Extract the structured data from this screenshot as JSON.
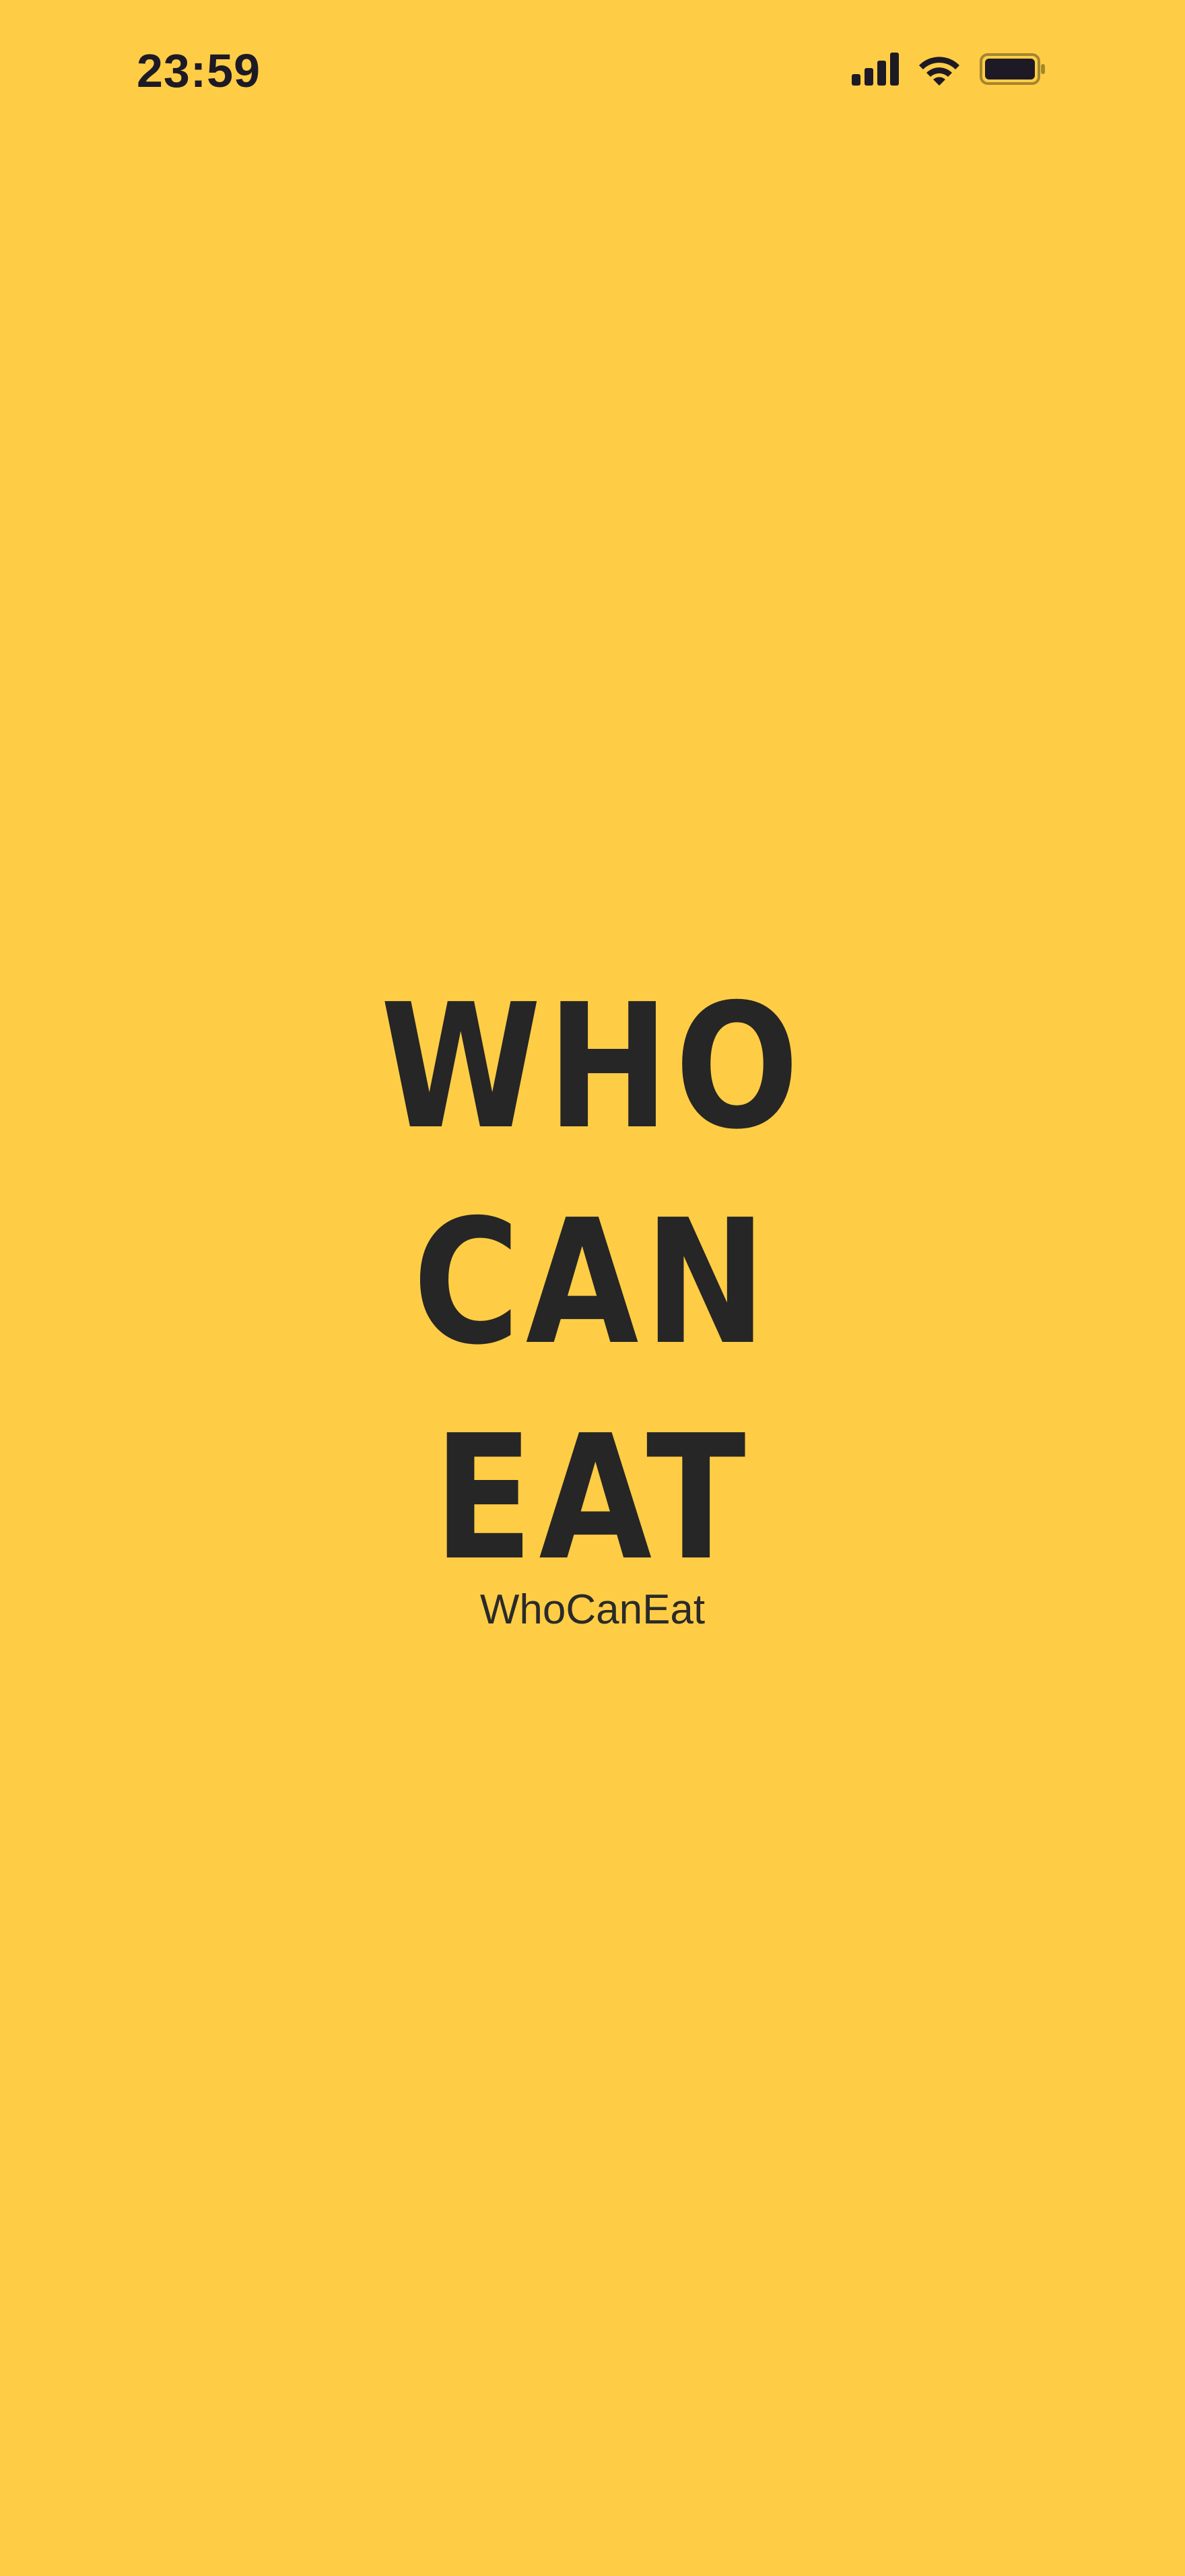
{
  "status_bar": {
    "time": "23:59",
    "icons": [
      "cellular-signal-icon",
      "wifi-icon",
      "battery-icon"
    ],
    "battery_level": 1.0
  },
  "splash": {
    "logo_lines": [
      "WHO",
      "CAN",
      "EAT"
    ],
    "subtitle": "WhoCanEat"
  },
  "colors": {
    "background": "#FFCD45",
    "text": "#262626",
    "status_icons": "#1d1a26"
  }
}
